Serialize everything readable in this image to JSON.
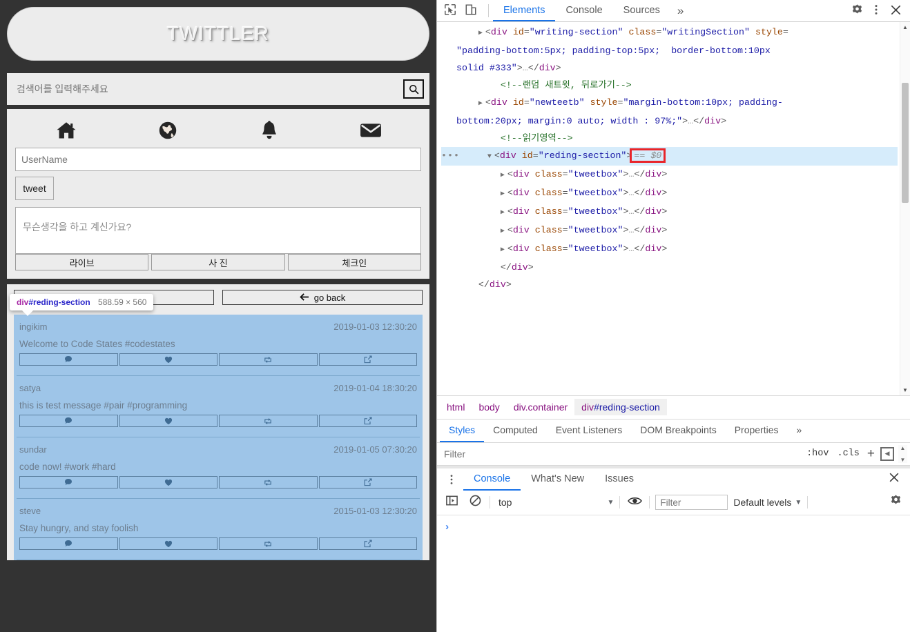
{
  "page": {
    "banner_title": "TWITTLER",
    "search": {
      "placeholder": "검색어를 입력해주세요",
      "icon": "search-icon"
    },
    "nav_icons": [
      "home-icon",
      "globe-icon",
      "bell-icon",
      "envelope-icon"
    ],
    "username_placeholder": "UserName",
    "tweet_button": "tweet",
    "compose_placeholder": "무슨생각을 하고 계신가요?",
    "compose_actions": [
      "라이브",
      "사 진",
      "체크인"
    ],
    "reading_toolbar": {
      "left_button": "",
      "right_button": "go back",
      "back_arrow": "arrow-left-icon"
    },
    "tweet_action_icons": [
      "comment-icon",
      "heart-icon",
      "retweet-icon",
      "share-icon"
    ],
    "tweets": [
      {
        "user": "ingikim",
        "time": "2019-01-03 12:30:20",
        "message": "Welcome to Code States #codestates"
      },
      {
        "user": "satya",
        "time": "2019-01-04 18:30:20",
        "message": "this is test message #pair #programming"
      },
      {
        "user": "sundar",
        "time": "2019-01-05 07:30:20",
        "message": "code now! #work #hard"
      },
      {
        "user": "steve",
        "time": "2015-01-03 12:30:20",
        "message": "Stay hungry, and stay foolish"
      }
    ],
    "inspect_tooltip": {
      "tag": "div",
      "id": "#reding-section",
      "dimensions": "588.59 × 560"
    },
    "colors": {
      "page_bg": "#333333",
      "panel_bg": "#ececec",
      "tweet_bg": "#9ec5e8",
      "tweet_text": "#6c7d8e"
    }
  },
  "devtools": {
    "toolbar_icons": [
      "inspect-element-icon",
      "device-toolbar-icon"
    ],
    "tabs": [
      {
        "label": "Elements",
        "active": true
      },
      {
        "label": "Console",
        "active": false
      },
      {
        "label": "Sources",
        "active": false
      }
    ],
    "more_tabs": "»",
    "right_icons": [
      "gear-icon",
      "kebab-menu-icon",
      "close-icon"
    ],
    "dom_lines": [
      {
        "indent": 1,
        "parts": [
          {
            "t": "tri",
            "v": "▶"
          },
          {
            "t": "pu",
            "v": "<"
          },
          {
            "t": "tw",
            "v": "div"
          },
          {
            "t": "sp",
            "v": " "
          },
          {
            "t": "at",
            "v": "id"
          },
          {
            "t": "pu",
            "v": "="
          },
          {
            "t": "av",
            "v": "\"writing-section\""
          },
          {
            "t": "sp",
            "v": " "
          },
          {
            "t": "at",
            "v": "class"
          },
          {
            "t": "pu",
            "v": "="
          },
          {
            "t": "av",
            "v": "\"writingSection\""
          },
          {
            "t": "sp",
            "v": " "
          },
          {
            "t": "at",
            "v": "style"
          },
          {
            "t": "pu",
            "v": "="
          }
        ]
      },
      {
        "indent": 0,
        "parts": [
          {
            "t": "av",
            "v": "\"padding-bottom:5px; padding-top:5px;  border-bottom:10px"
          }
        ]
      },
      {
        "indent": 0,
        "parts": [
          {
            "t": "av",
            "v": "solid #333\""
          },
          {
            "t": "pu",
            "v": ">"
          },
          {
            "t": "el",
            "v": "…"
          },
          {
            "t": "pu",
            "v": "</"
          },
          {
            "t": "tw",
            "v": "div"
          },
          {
            "t": "pu",
            "v": ">"
          }
        ]
      },
      {
        "indent": 2,
        "parts": [
          {
            "t": "cm",
            "v": "<!--랜덤 새트윗, 뒤로가기-->"
          }
        ]
      },
      {
        "indent": 1,
        "parts": [
          {
            "t": "tri",
            "v": "▶"
          },
          {
            "t": "pu",
            "v": "<"
          },
          {
            "t": "tw",
            "v": "div"
          },
          {
            "t": "sp",
            "v": " "
          },
          {
            "t": "at",
            "v": "id"
          },
          {
            "t": "pu",
            "v": "="
          },
          {
            "t": "av",
            "v": "\"newteetb\""
          },
          {
            "t": "sp",
            "v": " "
          },
          {
            "t": "at",
            "v": "style"
          },
          {
            "t": "pu",
            "v": "="
          },
          {
            "t": "av",
            "v": "\"margin-bottom:10px; padding-"
          }
        ]
      },
      {
        "indent": 0,
        "parts": [
          {
            "t": "av",
            "v": "bottom:20px; margin:0 auto; width : 97%;\""
          },
          {
            "t": "pu",
            "v": ">"
          },
          {
            "t": "el",
            "v": "…"
          },
          {
            "t": "pu",
            "v": "</"
          },
          {
            "t": "tw",
            "v": "div"
          },
          {
            "t": "pu",
            "v": ">"
          }
        ]
      },
      {
        "indent": 2,
        "parts": [
          {
            "t": "cm",
            "v": "<!--읽기영역-->"
          }
        ]
      },
      {
        "indent": 1,
        "selected": true,
        "dots": true,
        "parts": [
          {
            "t": "tri",
            "v": "▼"
          },
          {
            "t": "pu",
            "v": "<"
          },
          {
            "t": "tw",
            "v": "div"
          },
          {
            "t": "sp",
            "v": " "
          },
          {
            "t": "at",
            "v": "id"
          },
          {
            "t": "pu",
            "v": "="
          },
          {
            "t": "av",
            "v": "\"reding-section\""
          },
          {
            "t": "pu",
            "v": ">"
          },
          {
            "t": "hl",
            "v": "== $0"
          }
        ]
      },
      {
        "indent": 2,
        "parts": [
          {
            "t": "tri",
            "v": "▶"
          },
          {
            "t": "pu",
            "v": "<"
          },
          {
            "t": "tw",
            "v": "div"
          },
          {
            "t": "sp",
            "v": " "
          },
          {
            "t": "at",
            "v": "class"
          },
          {
            "t": "pu",
            "v": "="
          },
          {
            "t": "av",
            "v": "\"tweetbox\""
          },
          {
            "t": "pu",
            "v": ">"
          },
          {
            "t": "el",
            "v": "…"
          },
          {
            "t": "pu",
            "v": "</"
          },
          {
            "t": "tw",
            "v": "div"
          },
          {
            "t": "pu",
            "v": ">"
          }
        ]
      },
      {
        "indent": 2,
        "parts": [
          {
            "t": "tri",
            "v": "▶"
          },
          {
            "t": "pu",
            "v": "<"
          },
          {
            "t": "tw",
            "v": "div"
          },
          {
            "t": "sp",
            "v": " "
          },
          {
            "t": "at",
            "v": "class"
          },
          {
            "t": "pu",
            "v": "="
          },
          {
            "t": "av",
            "v": "\"tweetbox\""
          },
          {
            "t": "pu",
            "v": ">"
          },
          {
            "t": "el",
            "v": "…"
          },
          {
            "t": "pu",
            "v": "</"
          },
          {
            "t": "tw",
            "v": "div"
          },
          {
            "t": "pu",
            "v": ">"
          }
        ]
      },
      {
        "indent": 2,
        "parts": [
          {
            "t": "tri",
            "v": "▶"
          },
          {
            "t": "pu",
            "v": "<"
          },
          {
            "t": "tw",
            "v": "div"
          },
          {
            "t": "sp",
            "v": " "
          },
          {
            "t": "at",
            "v": "class"
          },
          {
            "t": "pu",
            "v": "="
          },
          {
            "t": "av",
            "v": "\"tweetbox\""
          },
          {
            "t": "pu",
            "v": ">"
          },
          {
            "t": "el",
            "v": "…"
          },
          {
            "t": "pu",
            "v": "</"
          },
          {
            "t": "tw",
            "v": "div"
          },
          {
            "t": "pu",
            "v": ">"
          }
        ]
      },
      {
        "indent": 2,
        "parts": [
          {
            "t": "tri",
            "v": "▶"
          },
          {
            "t": "pu",
            "v": "<"
          },
          {
            "t": "tw",
            "v": "div"
          },
          {
            "t": "sp",
            "v": " "
          },
          {
            "t": "at",
            "v": "class"
          },
          {
            "t": "pu",
            "v": "="
          },
          {
            "t": "av",
            "v": "\"tweetbox\""
          },
          {
            "t": "pu",
            "v": ">"
          },
          {
            "t": "el",
            "v": "…"
          },
          {
            "t": "pu",
            "v": "</"
          },
          {
            "t": "tw",
            "v": "div"
          },
          {
            "t": "pu",
            "v": ">"
          }
        ]
      },
      {
        "indent": 2,
        "parts": [
          {
            "t": "tri",
            "v": "▶"
          },
          {
            "t": "pu",
            "v": "<"
          },
          {
            "t": "tw",
            "v": "div"
          },
          {
            "t": "sp",
            "v": " "
          },
          {
            "t": "at",
            "v": "class"
          },
          {
            "t": "pu",
            "v": "="
          },
          {
            "t": "av",
            "v": "\"tweetbox\""
          },
          {
            "t": "pu",
            "v": ">"
          },
          {
            "t": "el",
            "v": "…"
          },
          {
            "t": "pu",
            "v": "</"
          },
          {
            "t": "tw",
            "v": "div"
          },
          {
            "t": "pu",
            "v": ">"
          }
        ]
      },
      {
        "indent": 2,
        "parts": [
          {
            "t": "pu",
            "v": "</"
          },
          {
            "t": "tw",
            "v": "div"
          },
          {
            "t": "pu",
            "v": ">"
          }
        ]
      },
      {
        "indent": 1,
        "parts": [
          {
            "t": "pu",
            "v": "</"
          },
          {
            "t": "tw",
            "v": "div"
          },
          {
            "t": "pu",
            "v": ">"
          }
        ]
      }
    ],
    "breadcrumb": [
      {
        "label": "html",
        "active": false
      },
      {
        "label": "body",
        "active": false
      },
      {
        "label": "div.container",
        "active": false
      },
      {
        "label": "div#reding-section",
        "active": true
      }
    ],
    "styles_tabs": [
      {
        "label": "Styles",
        "active": true
      },
      {
        "label": "Computed",
        "active": false
      },
      {
        "label": "Event Listeners",
        "active": false
      },
      {
        "label": "DOM Breakpoints",
        "active": false
      },
      {
        "label": "Properties",
        "active": false
      }
    ],
    "styles_more": "»",
    "styles_filter_placeholder": "Filter",
    "hov_label": ":hov",
    "cls_label": ".cls",
    "plus_label": "+",
    "console_drawer": {
      "tabs": [
        {
          "label": "Console",
          "active": true
        },
        {
          "label": "What's New",
          "active": false
        },
        {
          "label": "Issues",
          "active": false
        }
      ],
      "context": "top",
      "filter_placeholder": "Filter",
      "levels": "Default levels",
      "prompt": "›",
      "icons": [
        "sidebar-toggle-icon",
        "clear-console-icon",
        "eye-icon",
        "settings-gear-icon",
        "close-icon",
        "kebab-menu-icon"
      ]
    }
  }
}
